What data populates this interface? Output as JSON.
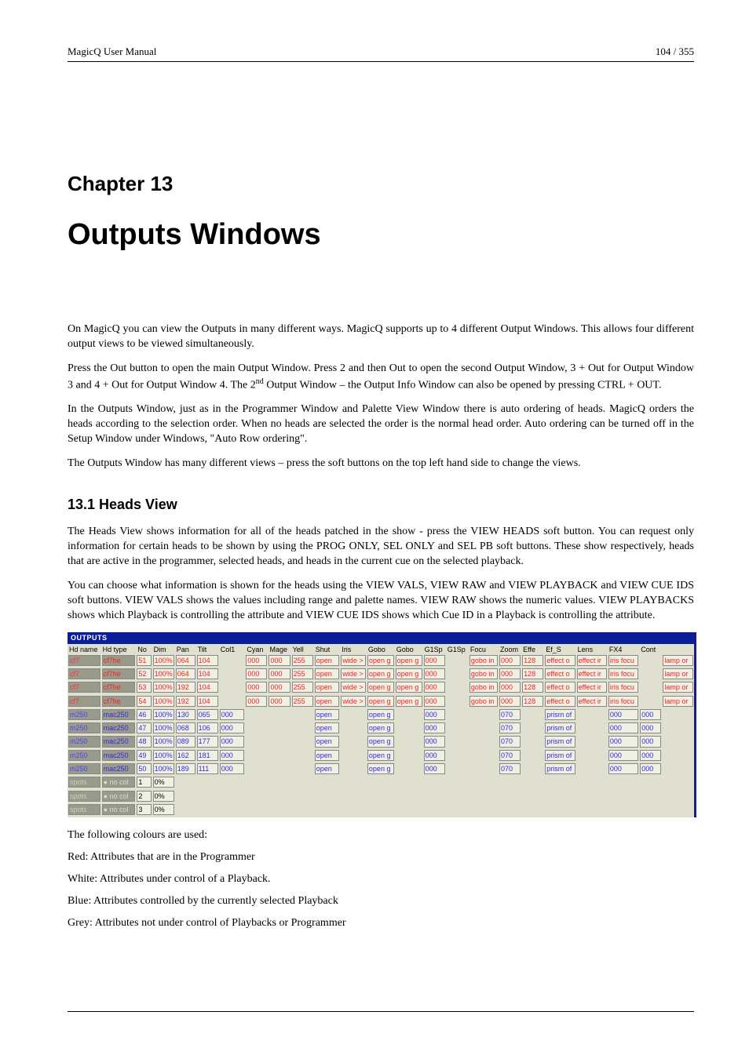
{
  "header": {
    "left": "MagicQ User Manual",
    "right": "104 / 355"
  },
  "chapter": {
    "label": "Chapter 13",
    "title": "Outputs Windows"
  },
  "paragraphs": {
    "p1": "On MagicQ you can view the Outputs in many different ways. MagicQ supports up to 4 different Output Windows. This allows four different output views to be viewed simultaneously.",
    "p2a": "Press the Out button to open the main Output Window. Press 2 and then Out to open the second Output Window, 3 + Out for Output Window 3 and 4 + Out for Output Window 4. The 2",
    "p2sup": "nd",
    "p2b": " Output Window – the Output Info Window can also be opened by pressing CTRL + OUT.",
    "p3": "In the Outputs Window, just as in the Programmer Window and Palette View Window there is auto ordering of heads. MagicQ orders the heads according to the selection order. When no heads are selected the order is the normal head order. Auto ordering can be turned off in the Setup Window under Windows, \"Auto Row ordering\".",
    "p4": "The Outputs Window has many different views – press the soft buttons on the top left hand side to change the views."
  },
  "section": {
    "heading": "13.1   Heads View",
    "s1": "The Heads View shows information for all of the heads patched in the show - press the VIEW HEADS soft button. You can request only information for certain heads to be shown by using the PROG ONLY, SEL ONLY and SEL PB soft buttons. These show respectively, heads that are active in the programmer, selected heads, and heads in the current cue on the selected playback.",
    "s2": "You can choose what information is shown for the heads using the VIEW VALS, VIEW RAW and VIEW PLAYBACK and VIEW CUE IDS soft buttons. VIEW VALS shows the values including range and palette names. VIEW RAW shows the numeric values. VIEW PLAYBACKS shows which Playback is controlling the attribute and VIEW CUE IDS shows which Cue ID in a Playback is controlling the attribute."
  },
  "screenshot": {
    "title": "OUTPUTS",
    "columns": [
      "Hd name",
      "Hd type",
      "No",
      "Dim",
      "Pan",
      "Tilt",
      "Col1",
      "Cyan",
      "Mage",
      "Yell",
      "Shut",
      "Iris",
      "Gobo",
      "Gobo",
      "G1Sp",
      "G1Sp",
      "Focu",
      "Zoom",
      "Effe",
      "Ef_S",
      "Lens",
      "FX4",
      "Cont"
    ],
    "rows": [
      {
        "cls": "red",
        "hd": "cf7",
        "type": "cf7he",
        "no": "51",
        "dim": "100%",
        "pan": "064",
        "tilt": "104",
        "col1": "",
        "cyan": "000",
        "mage": "000",
        "yell": "255",
        "shut": "open",
        "iris": "wide >",
        "g1": "open g",
        "g2": "open g",
        "g1sp": "000",
        "g1sp2": "",
        "focu": "gobo in",
        "zoom": "000",
        "effe": "128",
        "efs": "effect o",
        "lens": "effect ir",
        "fx4": "iris focu",
        "cont": "",
        "extra": "lamp or"
      },
      {
        "cls": "red",
        "hd": "cf7",
        "type": "cf7he",
        "no": "52",
        "dim": "100%",
        "pan": "064",
        "tilt": "104",
        "col1": "",
        "cyan": "000",
        "mage": "000",
        "yell": "255",
        "shut": "open",
        "iris": "wide >",
        "g1": "open g",
        "g2": "open g",
        "g1sp": "000",
        "g1sp2": "",
        "focu": "gobo in",
        "zoom": "000",
        "effe": "128",
        "efs": "effect o",
        "lens": "effect ir",
        "fx4": "iris focu",
        "cont": "",
        "extra": "lamp or"
      },
      {
        "cls": "red",
        "hd": "cf7",
        "type": "cf7he",
        "no": "53",
        "dim": "100%",
        "pan": "192",
        "tilt": "104",
        "col1": "",
        "cyan": "000",
        "mage": "000",
        "yell": "255",
        "shut": "open",
        "iris": "wide >",
        "g1": "open g",
        "g2": "open g",
        "g1sp": "000",
        "g1sp2": "",
        "focu": "gobo in",
        "zoom": "000",
        "effe": "128",
        "efs": "effect o",
        "lens": "effect ir",
        "fx4": "iris focu",
        "cont": "",
        "extra": "lamp or"
      },
      {
        "cls": "red",
        "hd": "cf7",
        "type": "cf7he",
        "no": "54",
        "dim": "100%",
        "pan": "192",
        "tilt": "104",
        "col1": "",
        "cyan": "000",
        "mage": "000",
        "yell": "255",
        "shut": "open",
        "iris": "wide >",
        "g1": "open g",
        "g2": "open g",
        "g1sp": "000",
        "g1sp2": "",
        "focu": "gobo in",
        "zoom": "000",
        "effe": "128",
        "efs": "effect o",
        "lens": "effect ir",
        "fx4": "iris focu",
        "cont": "",
        "extra": "lamp or"
      },
      {
        "cls": "blue",
        "hd": "m250",
        "type": "mac250",
        "no": "46",
        "dim": "100%",
        "pan": "130",
        "tilt": "065",
        "col1": "000",
        "cyan": "",
        "mage": "",
        "yell": "",
        "shut": "open",
        "iris": "",
        "g1": "open g",
        "g2": "",
        "g1sp": "000",
        "g1sp2": "",
        "focu": "",
        "zoom": "070",
        "effe": "",
        "efs": "prism of",
        "lens": "",
        "fx4": "000",
        "cont": "000",
        "extra": ""
      },
      {
        "cls": "blue",
        "hd": "m250",
        "type": "mac250",
        "no": "47",
        "dim": "100%",
        "pan": "068",
        "tilt": "106",
        "col1": "000",
        "cyan": "",
        "mage": "",
        "yell": "",
        "shut": "open",
        "iris": "",
        "g1": "open g",
        "g2": "",
        "g1sp": "000",
        "g1sp2": "",
        "focu": "",
        "zoom": "070",
        "effe": "",
        "efs": "prism of",
        "lens": "",
        "fx4": "000",
        "cont": "000",
        "extra": ""
      },
      {
        "cls": "blue",
        "hd": "m250",
        "type": "mac250",
        "no": "48",
        "dim": "100%",
        "pan": "089",
        "tilt": "177",
        "col1": "000",
        "cyan": "",
        "mage": "",
        "yell": "",
        "shut": "open",
        "iris": "",
        "g1": "open g",
        "g2": "",
        "g1sp": "000",
        "g1sp2": "",
        "focu": "",
        "zoom": "070",
        "effe": "",
        "efs": "prism of",
        "lens": "",
        "fx4": "000",
        "cont": "000",
        "extra": ""
      },
      {
        "cls": "blue",
        "hd": "m250",
        "type": "mac250",
        "no": "49",
        "dim": "100%",
        "pan": "162",
        "tilt": "181",
        "col1": "000",
        "cyan": "",
        "mage": "",
        "yell": "",
        "shut": "open",
        "iris": "",
        "g1": "open g",
        "g2": "",
        "g1sp": "000",
        "g1sp2": "",
        "focu": "",
        "zoom": "070",
        "effe": "",
        "efs": "prism of",
        "lens": "",
        "fx4": "000",
        "cont": "000",
        "extra": ""
      },
      {
        "cls": "blue",
        "hd": "m250",
        "type": "mac250",
        "no": "50",
        "dim": "100%",
        "pan": "189",
        "tilt": "111",
        "col1": "000",
        "cyan": "",
        "mage": "",
        "yell": "",
        "shut": "open",
        "iris": "",
        "g1": "open g",
        "g2": "",
        "g1sp": "000",
        "g1sp2": "",
        "focu": "",
        "zoom": "070",
        "effe": "",
        "efs": "prism of",
        "lens": "",
        "fx4": "000",
        "cont": "000",
        "extra": ""
      },
      {
        "cls": "",
        "hd": "spots",
        "type": "● no col",
        "no": "1",
        "dim": "0%",
        "pan": "",
        "tilt": "",
        "col1": "",
        "cyan": "",
        "mage": "",
        "yell": "",
        "shut": "",
        "iris": "",
        "g1": "",
        "g2": "",
        "g1sp": "",
        "g1sp2": "",
        "focu": "",
        "zoom": "",
        "effe": "",
        "efs": "",
        "lens": "",
        "fx4": "",
        "cont": "",
        "extra": ""
      },
      {
        "cls": "",
        "hd": "spots",
        "type": "● no col",
        "no": "2",
        "dim": "0%",
        "pan": "",
        "tilt": "",
        "col1": "",
        "cyan": "",
        "mage": "",
        "yell": "",
        "shut": "",
        "iris": "",
        "g1": "",
        "g2": "",
        "g1sp": "",
        "g1sp2": "",
        "focu": "",
        "zoom": "",
        "effe": "",
        "efs": "",
        "lens": "",
        "fx4": "",
        "cont": "",
        "extra": ""
      },
      {
        "cls": "",
        "hd": "spots",
        "type": "● no col",
        "no": "3",
        "dim": "0%",
        "pan": "",
        "tilt": "",
        "col1": "",
        "cyan": "",
        "mage": "",
        "yell": "",
        "shut": "",
        "iris": "",
        "g1": "",
        "g2": "",
        "g1sp": "",
        "g1sp2": "",
        "focu": "",
        "zoom": "",
        "effe": "",
        "efs": "",
        "lens": "",
        "fx4": "",
        "cont": "",
        "extra": ""
      }
    ]
  },
  "colours": {
    "intro": "The following colours are used:",
    "c1": "Red: Attributes that are in the Programmer",
    "c2": "White: Attributes under control of a Playback.",
    "c3": "Blue: Attributes controlled by the currently selected Playback",
    "c4": "Grey: Attributes not under control of Playbacks or Programmer"
  }
}
